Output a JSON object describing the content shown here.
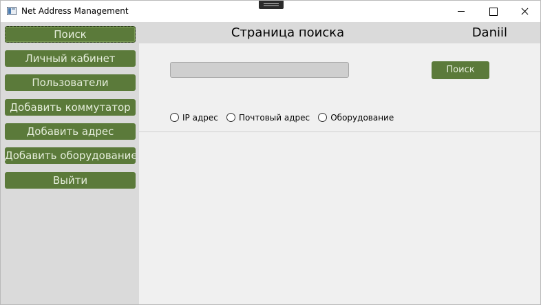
{
  "window": {
    "title": "Net Address Management"
  },
  "header": {
    "page_title": "Страница поиска",
    "username": "Daniil"
  },
  "sidebar": {
    "items": [
      {
        "label": "Поиск",
        "active": true
      },
      {
        "label": "Личный кабинет"
      },
      {
        "label": "Пользователи"
      },
      {
        "label": "Добавить коммутатор"
      },
      {
        "label": "Добавить адрес"
      },
      {
        "label": "Добавить оборудование"
      },
      {
        "label": "Выйти"
      }
    ]
  },
  "search": {
    "value": "",
    "placeholder": "",
    "button_label": "Поиск",
    "options": [
      {
        "label": "IP адрес",
        "checked": false
      },
      {
        "label": "Почтовый адрес",
        "checked": false
      },
      {
        "label": "Оборудование",
        "checked": false
      }
    ]
  },
  "colors": {
    "accent": "#5b7a3a",
    "sidebar_bg": "#dadada",
    "content_bg": "#f0f0f0"
  }
}
